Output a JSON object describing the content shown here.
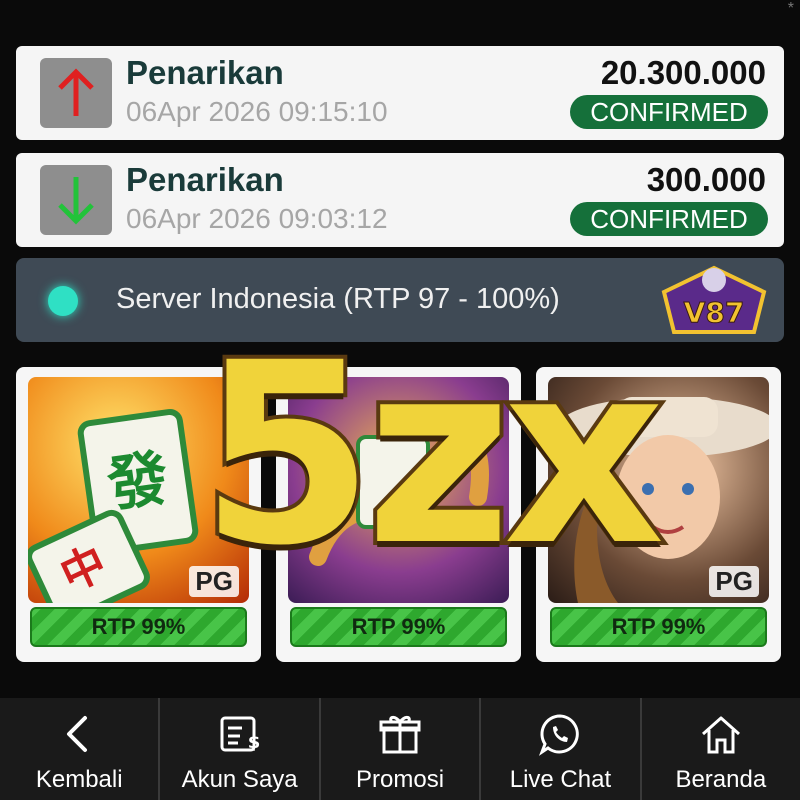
{
  "transactions": [
    {
      "title": "Penarikan",
      "date": "06Apr 2026 09:15:10",
      "amount": "20.300.000",
      "status": "CONFIRMED",
      "direction": "up",
      "arrow_color": "#e02020"
    },
    {
      "title": "Penarikan",
      "date": "06Apr 2026 09:03:12",
      "amount": "300.000",
      "status": "CONFIRMED",
      "direction": "down",
      "arrow_color": "#22c33a"
    }
  ],
  "server": {
    "label": "Server Indonesia (RTP 97 - 100%)",
    "indicator_color": "#2fe0c4"
  },
  "logo": {
    "text": "V87"
  },
  "overlay": {
    "text": "5zx"
  },
  "games": [
    {
      "icon": "mahjong-tile-icon",
      "provider": "PG",
      "rtp": "RTP 99%"
    },
    {
      "icon": "dragon-icon",
      "provider": "",
      "rtp": "RTP 99%"
    },
    {
      "icon": "cowgirl-icon",
      "provider": "PG",
      "rtp": "RTP 99%"
    }
  ],
  "nav": [
    {
      "label": "Kembali",
      "icon": "chevron-left-icon"
    },
    {
      "label": "Akun Saya",
      "icon": "invoice-dollar-icon"
    },
    {
      "label": "Promosi",
      "icon": "gift-icon"
    },
    {
      "label": "Live Chat",
      "icon": "whatsapp-icon"
    },
    {
      "label": "Beranda",
      "icon": "home-icon"
    }
  ],
  "colors": {
    "status_green": "#15703a",
    "overlay_gold": "#f0d33a",
    "nav_bg": "#1a1a1a"
  }
}
